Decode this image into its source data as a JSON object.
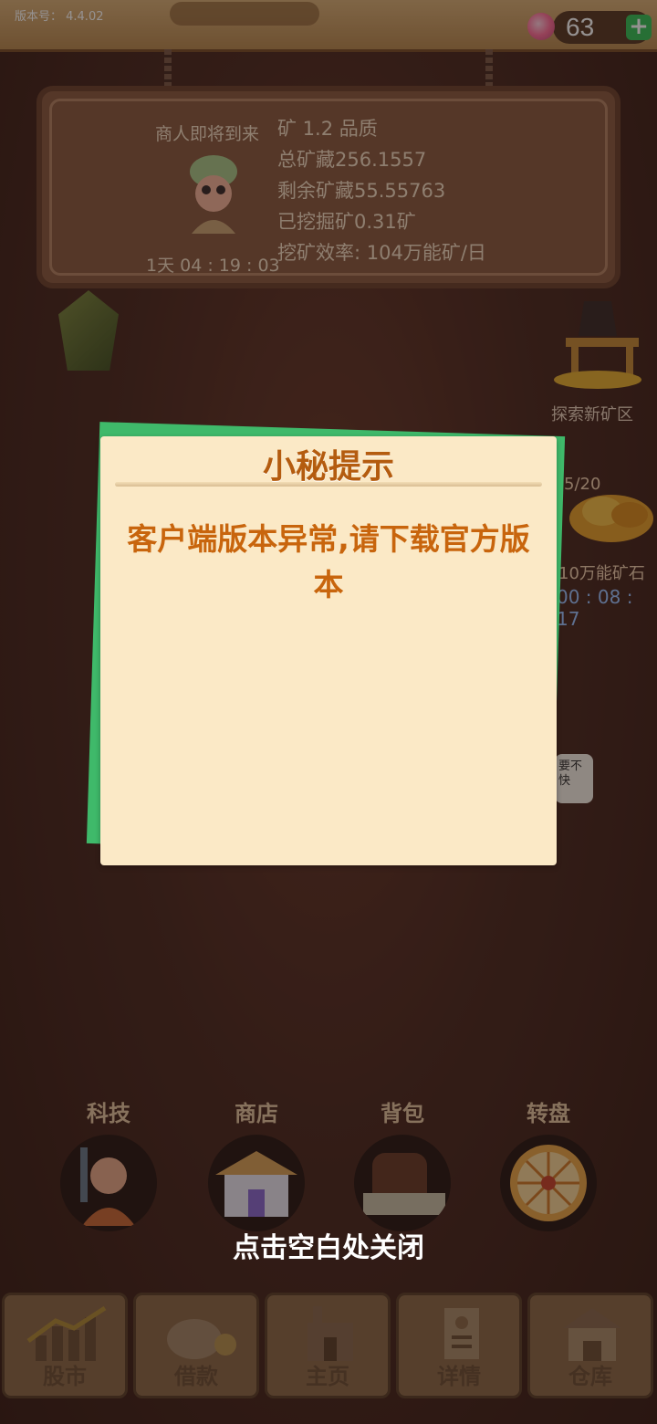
{
  "header": {
    "version_text": "版本号： 4.4.02",
    "gem_count": "63",
    "add_label": "+"
  },
  "mine_sign": {
    "merchant_label": "商人即将到来",
    "merchant_timer": "1天 04 : 19 : 03",
    "lines": [
      "矿 1.2 品质",
      "总矿藏256.1557",
      "剩余矿藏55.55763",
      "已挖掘矿0.31矿",
      "挖矿效率: 104万能矿/日"
    ]
  },
  "side": {
    "explore_label": "探索新矿区",
    "stone_count": "5/20",
    "stone_label": "10万能矿石",
    "stone_timer": "00 : 08 : 17",
    "chat_text": "要不\n快"
  },
  "quick_actions": [
    {
      "label": "科技"
    },
    {
      "label": "商店"
    },
    {
      "label": "背包"
    },
    {
      "label": "转盘"
    }
  ],
  "modal": {
    "title": "小秘提示",
    "message": "客户端版本异常,请下载官方版本"
  },
  "close_hint": "点击空白处关闭",
  "tabs": [
    {
      "label": "股市"
    },
    {
      "label": "借款"
    },
    {
      "label": "主页"
    },
    {
      "label": "详情"
    },
    {
      "label": "仓库"
    }
  ],
  "colors": {
    "modal_bg": "#fbe9c6",
    "modal_accent": "#3fb96a",
    "title_color": "#b45c0f",
    "message_color": "#c8650d"
  }
}
